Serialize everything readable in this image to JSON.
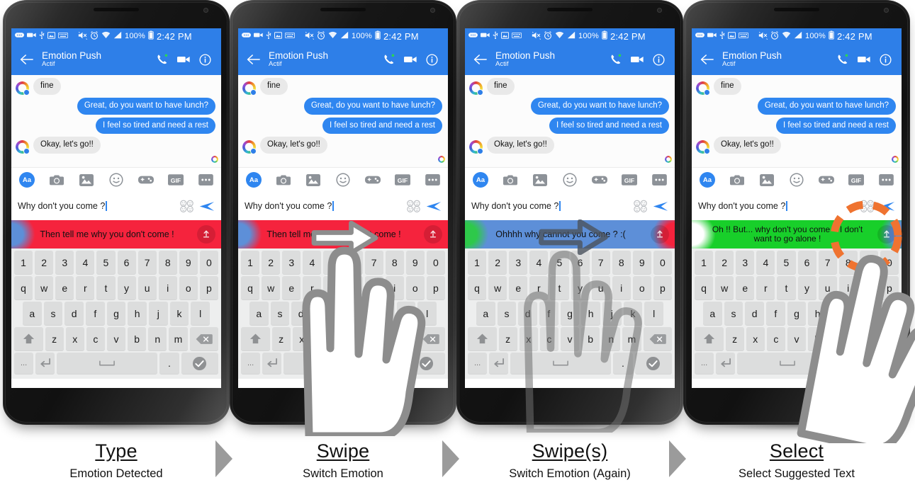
{
  "status_bar": {
    "battery_percent": "100%",
    "time": "2:42 PM",
    "icons": [
      "sms-icon",
      "video-icon",
      "usb-icon",
      "image-icon",
      "keyboard-icon",
      "mute-icon",
      "alarm-icon",
      "wifi-icon",
      "signal-icon",
      "battery-icon"
    ]
  },
  "app_header": {
    "title": "Emotion Push",
    "subtitle": "Actif",
    "icons": [
      "back-arrow-icon",
      "phone-call-icon",
      "video-call-icon",
      "info-icon"
    ]
  },
  "conversation": [
    {
      "side": "in",
      "text": "fine"
    },
    {
      "side": "out",
      "text": "Great, do you want to have lunch?"
    },
    {
      "side": "out",
      "text": "I feel so tired and need a rest"
    },
    {
      "side": "in",
      "text": "Okay, let's go!!"
    }
  ],
  "composer": {
    "tools": [
      "Aa",
      "camera-icon",
      "photo-icon",
      "smiley-icon",
      "gamepad-icon",
      "GIF",
      "more-icon"
    ],
    "gif_label": "GIF",
    "aa_label": "Aa",
    "input_value": "Why don't you come ?",
    "sticker_icon": "sticker-icon",
    "send_icon": "send-icon"
  },
  "keyboard": {
    "row_numbers": [
      "1",
      "2",
      "3",
      "4",
      "5",
      "6",
      "7",
      "8",
      "9",
      "0"
    ],
    "row_top": [
      "q",
      "w",
      "e",
      "r",
      "t",
      "y",
      "u",
      "i",
      "o",
      "p"
    ],
    "row_home": [
      "a",
      "s",
      "d",
      "f",
      "g",
      "h",
      "j",
      "k",
      "l"
    ],
    "row_bottom": [
      "z",
      "x",
      "c",
      "v",
      "b",
      "n",
      "m"
    ],
    "shift_icon": "shift-icon",
    "backspace_icon": "backspace-icon",
    "symbols_label": "...",
    "enter_icon": "enter-icon",
    "space_icon": "space-icon",
    "period_label": ".",
    "done_icon": "done-check-icon"
  },
  "panels": [
    {
      "id": "panel-type",
      "suggestion_text": "Then tell me why you don't come !",
      "suggestion_color": "#f5233d",
      "suggestion_edge_left": "#5d8fd8",
      "suggestion_edge_right": "#f5233d",
      "caption_title": "Type",
      "caption_sub": "Emotion Detected",
      "gesture": "none"
    },
    {
      "id": "panel-swipe",
      "suggestion_text": "Then tell me why you don't come !",
      "suggestion_color": "#f5233d",
      "suggestion_edge_left": "#5d8fd8",
      "suggestion_edge_right": "#f5233d",
      "caption_title": "Swipe",
      "caption_sub": "Switch Emotion",
      "gesture": "hand-swipe-white-arrow"
    },
    {
      "id": "panel-swipes",
      "suggestion_text": "Ohhhh why cannot you come ? :(",
      "suggestion_color": "#5d8fd8",
      "suggestion_edge_left": "#2ec94a",
      "suggestion_edge_right": "#f5233d",
      "caption_title": "Swipe(s)",
      "caption_sub": "Switch Emotion (Again)",
      "gesture": "hand-swipe-outline-arrow"
    },
    {
      "id": "panel-select",
      "suggestion_text": "Oh !! But... why don't you come ~ I don't want to go alone !",
      "suggestion_text_line1": "Oh !! But... why don't you come ~ I don't",
      "suggestion_text_line2": "want to go alone !",
      "suggestion_color": "#18cf2a",
      "suggestion_edge_left": "#ffffff",
      "suggestion_edge_right": "#5d8fd8",
      "caption_title": "Select",
      "caption_sub": "Select Suggested Text",
      "gesture": "hand-tap-highlight",
      "highlight_color": "#ef7330"
    }
  ],
  "separators": [
    "chevron-right-icon",
    "chevron-right-icon",
    "chevron-right-icon"
  ]
}
